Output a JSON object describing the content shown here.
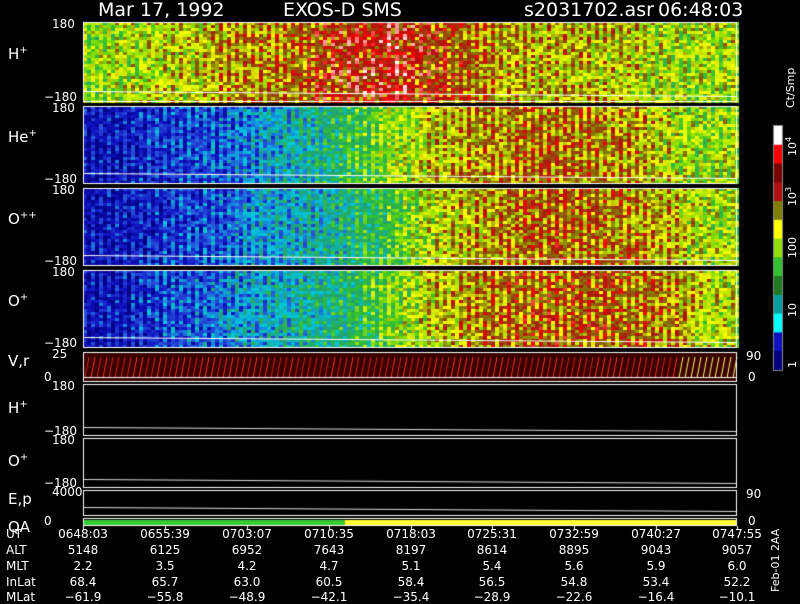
{
  "header": {
    "date": "Mar 17, 1992",
    "instrument": "EXOS-D SMS",
    "file": "s2031702.asr",
    "time": "06:48:03"
  },
  "chart_data": {
    "type": "heatmap",
    "panels": [
      {
        "label": "H",
        "sup": "+",
        "ymax": "180",
        "ymin": "−180",
        "kind": "spectrogram",
        "profile": [
          0.55,
          0.6,
          0.62,
          0.65,
          0.7,
          0.72,
          0.73,
          0.8,
          0.82,
          0.85,
          0.78,
          0.75,
          0.7,
          0.68,
          0.68,
          0.66,
          0.65,
          0.6,
          0.6,
          0.62
        ]
      },
      {
        "label": "He",
        "sup": "+",
        "ymax": "180",
        "ymin": "−180",
        "kind": "spectrogram",
        "profile": [
          0.08,
          0.1,
          0.15,
          0.18,
          0.2,
          0.28,
          0.32,
          0.4,
          0.48,
          0.58,
          0.66,
          0.7,
          0.72,
          0.74,
          0.73,
          0.72,
          0.7,
          0.62,
          0.58,
          0.6
        ]
      },
      {
        "label": "O",
        "sup": "++",
        "ymax": "180",
        "ymin": "−180",
        "kind": "spectrogram",
        "profile": [
          0.08,
          0.1,
          0.14,
          0.17,
          0.2,
          0.28,
          0.32,
          0.35,
          0.42,
          0.5,
          0.62,
          0.68,
          0.72,
          0.75,
          0.75,
          0.74,
          0.72,
          0.68,
          0.6,
          0.6
        ]
      },
      {
        "label": "O",
        "sup": "+",
        "ymax": "180",
        "ymin": "−180",
        "kind": "spectrogram",
        "profile": [
          0.08,
          0.1,
          0.16,
          0.2,
          0.24,
          0.3,
          0.35,
          0.38,
          0.45,
          0.55,
          0.65,
          0.7,
          0.74,
          0.76,
          0.76,
          0.76,
          0.74,
          0.72,
          0.64,
          0.62
        ]
      },
      {
        "label": "V,r",
        "sup": "",
        "ymax": "25",
        "ymin": "0",
        "right_top": "90",
        "right_bottom": "0",
        "kind": "lines"
      },
      {
        "label": "H",
        "sup": "+",
        "ymax": "180",
        "ymin": "−180",
        "kind": "empty"
      },
      {
        "label": "O",
        "sup": "+",
        "ymax": "180",
        "ymin": "−180",
        "kind": "empty"
      },
      {
        "label": "E,p",
        "sup": "",
        "ymax": "4000",
        "right_top": "90",
        "kind": "empty"
      },
      {
        "label": "QA",
        "sup": "",
        "ymin": "0",
        "right_bottom": "0",
        "kind": "qa"
      }
    ],
    "colorbar": {
      "unit": "Ct/Smp",
      "labels": [
        "10",
        "4",
        "10",
        "3",
        "100",
        "10",
        "1"
      ],
      "colors": [
        "#ffffff",
        "#ff0000",
        "#7a0000",
        "#b01010",
        "#808000",
        "#ffff00",
        "#90e000",
        "#30c030",
        "#207a20",
        "#00a0a0",
        "#00ffff",
        "#1010c0",
        "#000080"
      ]
    },
    "qa_colors": [
      "#33cc33",
      "#ffff33"
    ],
    "qa_split_fraction": 0.4,
    "ephemeris": {
      "rows": [
        "UT",
        "ALT",
        "MLT",
        "InLat",
        "MLat"
      ],
      "values": [
        [
          "0648:03",
          "0655:39",
          "0703:07",
          "0710:35",
          "0718:03",
          "0725:31",
          "0732:59",
          "0740:27",
          "0747:55"
        ],
        [
          "5148",
          "6125",
          "6952",
          "7643",
          "8197",
          "8614",
          "8895",
          "9043",
          "9057"
        ],
        [
          "2.2",
          "3.5",
          "4.2",
          "4.7",
          "5.1",
          "5.4",
          "5.6",
          "5.9",
          "6.0"
        ],
        [
          "68.4",
          "65.7",
          "63.0",
          "60.5",
          "58.4",
          "56.5",
          "54.8",
          "53.4",
          "52.2"
        ],
        [
          "−61.9",
          "−55.8",
          "−48.9",
          "−42.1",
          "−35.4",
          "−28.9",
          "−22.6",
          "−16.4",
          "−10.1"
        ]
      ]
    },
    "footer": "Feb-01  2AA"
  }
}
